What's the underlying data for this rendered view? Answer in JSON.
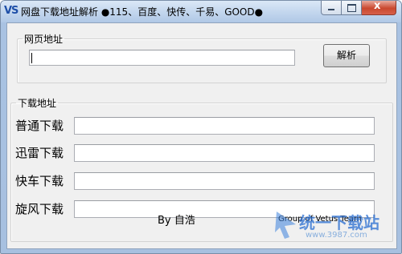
{
  "window": {
    "icon_text": "VS",
    "title": "网盘下载地址解析  ●115、百度、快传、千易、GOOD●",
    "close_symbol": "x"
  },
  "url_group": {
    "legend": "网页地址",
    "input_value": "",
    "parse_button": "解析"
  },
  "download_group": {
    "legend": "下载地址",
    "rows": [
      {
        "label": "普通下载",
        "value": ""
      },
      {
        "label": "迅雷下载",
        "value": ""
      },
      {
        "label": "快车下载",
        "value": ""
      },
      {
        "label": "旋风下载",
        "value": ""
      }
    ]
  },
  "footer": {
    "author": "By 自浩",
    "group": "Group of Vetus Team"
  },
  "watermark": {
    "text": "统一下载站",
    "sub": "www.3987.com"
  }
}
